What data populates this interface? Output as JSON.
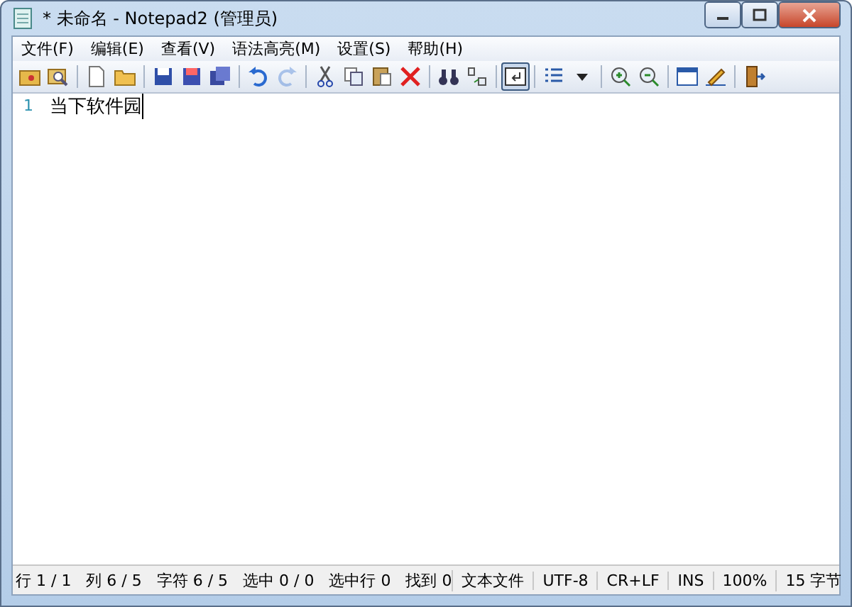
{
  "window": {
    "title": "* 未命名 - Notepad2 (管理员)"
  },
  "menu": [
    "文件(F)",
    "编辑(E)",
    "查看(V)",
    "语法高亮(M)",
    "设置(S)",
    "帮助(H)"
  ],
  "toolbar": [
    [
      {
        "selected": false,
        "disabled": false
      },
      {
        "selected": false,
        "disabled": false
      }
    ],
    [
      {
        "selected": false,
        "disabled": false
      },
      {
        "selected": false,
        "disabled": false
      }
    ],
    [
      {
        "selected": false,
        "disabled": false
      },
      {
        "selected": false,
        "disabled": false
      },
      {
        "selected": false,
        "disabled": false
      }
    ],
    [
      {
        "selected": false,
        "disabled": false
      },
      {
        "selected": false,
        "disabled": true
      }
    ],
    [
      {
        "selected": false,
        "disabled": false
      },
      {
        "selected": false,
        "disabled": false
      },
      {
        "selected": false,
        "disabled": false
      },
      {
        "selected": false,
        "disabled": false
      }
    ],
    [
      {
        "selected": false,
        "disabled": false
      },
      {
        "selected": false,
        "disabled": false
      }
    ],
    [
      {
        "selected": true,
        "disabled": false
      }
    ],
    [
      {
        "selected": false,
        "disabled": false
      },
      {
        "selected": false,
        "disabled": false
      }
    ],
    [
      {
        "selected": false,
        "disabled": false
      },
      {
        "selected": false,
        "disabled": false
      }
    ],
    [
      {
        "selected": false,
        "disabled": false
      },
      {
        "selected": false,
        "disabled": false
      }
    ],
    [
      {
        "selected": false,
        "disabled": false
      }
    ]
  ],
  "editor": {
    "lines": [
      {
        "number": "1",
        "text": "当下软件园"
      }
    ]
  },
  "status_bar": {
    "position": "行 1 / 1   列 6 / 5   字符 6 / 5   选中 0 / 0   选中行 0   找到 0",
    "fields": [
      "文本文件",
      "UTF-8",
      "CR+LF",
      "INS",
      "100%",
      "15 字节"
    ]
  }
}
